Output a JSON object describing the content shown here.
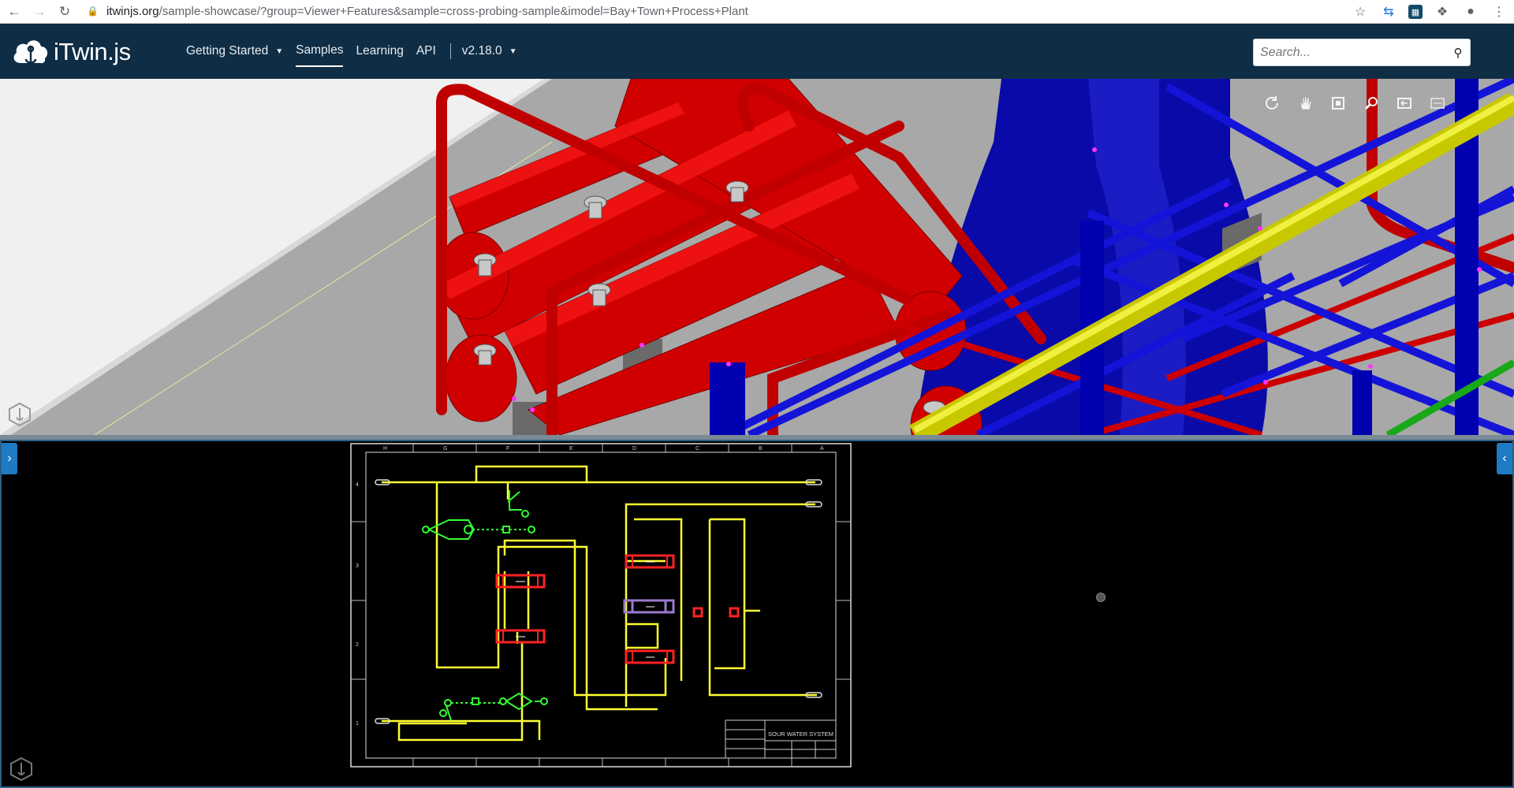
{
  "browser": {
    "url_domain": "itwinjs.org",
    "url_path": "/sample-showcase/?group=Viewer+Features&sample=cross-probing-sample&imodel=Bay+Town+Process+Plant",
    "icons": [
      "back-arrow-icon",
      "forward-arrow-icon",
      "reload-icon",
      "lock-icon",
      "star-icon",
      "sync-icon",
      "extension-icon",
      "puzzle-icon",
      "profile-icon",
      "kebab-menu-icon"
    ]
  },
  "header": {
    "logo_text": "iTwin.js",
    "nav": [
      {
        "label": "Getting Started",
        "dropdown": true
      },
      {
        "label": "Samples",
        "active": true
      },
      {
        "label": "Learning"
      },
      {
        "label": "API"
      }
    ],
    "version_label": "v2.18.0",
    "search_placeholder": "Search..."
  },
  "viewport3d": {
    "toolbar": [
      "rotate-icon",
      "pan-hand-icon",
      "fit-view-icon",
      "zoom-icon",
      "view-undo-icon",
      "view-redo-icon"
    ]
  },
  "viewport2d": {
    "left_tab_glyph": "›",
    "right_tab_glyph": "‹",
    "sheet": {
      "title_block": "SOUR WATER SYSTEM",
      "column_letters_top": [
        "H",
        "G",
        "F",
        "E",
        "D",
        "C",
        "B",
        "A"
      ],
      "row_numbers": [
        "4",
        "3",
        "2",
        "1"
      ]
    }
  },
  "colors": {
    "header_bg": "#0f2d44",
    "accent_blue": "#1f7ac4",
    "pipe_red": "#cc0000",
    "structure_blue": "#0000cc",
    "pipe_yellow": "#d4d400",
    "schematic_yellow": "#ffff33",
    "schematic_green": "#33ff33",
    "schematic_red": "#ff2222"
  }
}
